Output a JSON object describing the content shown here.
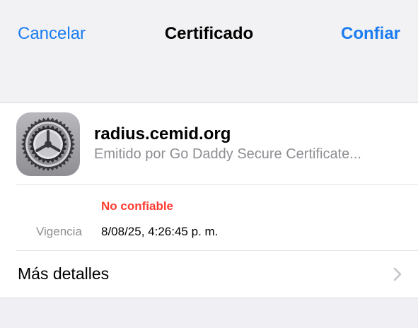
{
  "nav": {
    "cancel_label": "Cancelar",
    "title": "Certificado",
    "trust_label": "Confiar"
  },
  "certificate": {
    "name": "radius.cemid.org",
    "issuer": "Emitido por Go Daddy Secure Certificate...",
    "icon": "settings-gear-icon",
    "trust_status": "No confiable",
    "validity_label": "Vigencia",
    "validity_value": "8/08/25, 4:26:45 p. m."
  },
  "details": {
    "label": "Más detalles",
    "icon": "chevron-right-icon"
  },
  "colors": {
    "accent": "#1a7cf0",
    "warning": "#ff3b30",
    "secondary_text": "#8e8e93",
    "background": "#efeff4"
  }
}
